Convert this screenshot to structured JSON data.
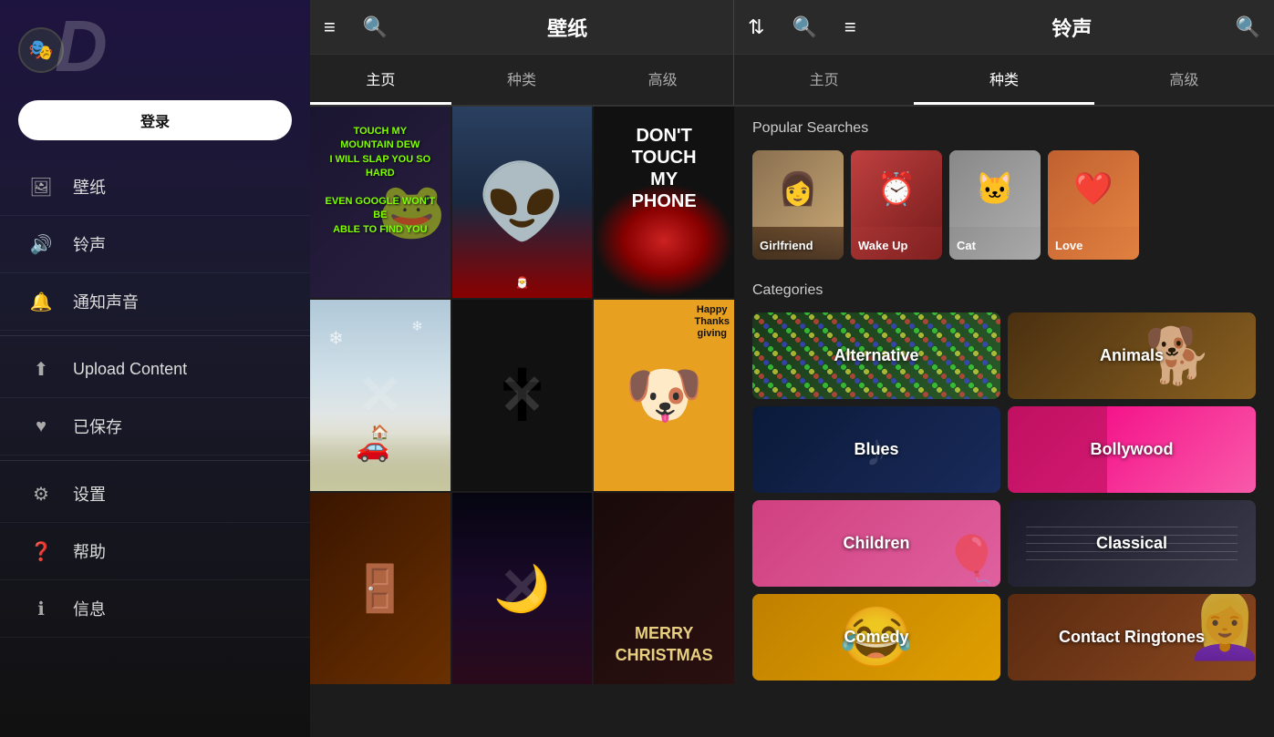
{
  "sidebar": {
    "logo_initial": "D",
    "login_label": "登录",
    "nav_items": [
      {
        "id": "wallpaper",
        "label": "壁纸",
        "icon": "🖼"
      },
      {
        "id": "ringtone",
        "label": "铃声",
        "icon": "🔊"
      },
      {
        "id": "notification",
        "label": "通知声音",
        "icon": "🔔"
      },
      {
        "id": "upload",
        "label": "Upload Content",
        "icon": "⬆"
      },
      {
        "id": "saved",
        "label": "已保存",
        "icon": "♥"
      },
      {
        "id": "settings",
        "label": "设置",
        "icon": "⚙"
      },
      {
        "id": "help",
        "label": "帮助",
        "icon": "❓"
      },
      {
        "id": "info",
        "label": "信息",
        "icon": "ℹ"
      }
    ]
  },
  "topbar": {
    "sort_icon": "≡",
    "search_icon": "🔍",
    "wallpaper_title": "壁纸",
    "wallpaper_sort": "⇅",
    "wallpaper_search": "🔍",
    "ringtone_menu": "≡",
    "ringtone_title": "铃声",
    "ringtone_search": "🔍"
  },
  "tabs": {
    "wallpaper_tabs": [
      "主页",
      "种类",
      "高级"
    ],
    "ringtone_tabs": [
      "主页",
      "种类",
      "高级"
    ]
  },
  "ringtone_panel": {
    "popular_searches_title": "Popular Searches",
    "search_items": [
      {
        "label": "Girlfriend",
        "bg_class": "thumb-girlfriend"
      },
      {
        "label": "Wake Up",
        "bg_class": "thumb-wakeup"
      },
      {
        "label": "Cat",
        "bg_class": "thumb-cat"
      },
      {
        "label": "Love",
        "bg_class": "thumb-love"
      }
    ],
    "categories_title": "Categories",
    "categories": [
      {
        "label": "Alternative",
        "bg_class": "cat-alternative"
      },
      {
        "label": "Animals",
        "bg_class": "cat-animals"
      },
      {
        "label": "Blues",
        "bg_class": "cat-blues"
      },
      {
        "label": "Bollywood",
        "bg_class": "cat-bollywood"
      },
      {
        "label": "Children",
        "bg_class": "cat-children"
      },
      {
        "label": "Classical",
        "bg_class": "cat-classical"
      },
      {
        "label": "Comedy",
        "bg_class": "cat-comedy"
      },
      {
        "label": "Contact Ringtones",
        "bg_class": "cat-contact"
      }
    ]
  },
  "wallpaper_grid": {
    "items": [
      {
        "id": "w1",
        "type": "text",
        "text": "TOUCH MY MOUNTAIN DEW\nI WILL SLAP YOU SO HARD\nEVEN GOOGLE WON'T BE\nABLE TO FIND YOU"
      },
      {
        "id": "w2",
        "type": "image",
        "desc": "Baby Yoda Christmas"
      },
      {
        "id": "w3",
        "type": "text",
        "text": "DON'T\nTOUCH\nMY\nPHONE"
      },
      {
        "id": "w4",
        "type": "image",
        "desc": "Winter farm scene"
      },
      {
        "id": "w5",
        "type": "image",
        "desc": "Jesus crown of thorns"
      },
      {
        "id": "w6",
        "type": "image",
        "desc": "Snoopy Thanksgiving"
      },
      {
        "id": "w7",
        "type": "image",
        "desc": "Christmas door"
      },
      {
        "id": "w8",
        "type": "image",
        "desc": "Space moon"
      },
      {
        "id": "w9",
        "type": "text",
        "text": "MERRY\nCHRISTMAS"
      }
    ]
  }
}
